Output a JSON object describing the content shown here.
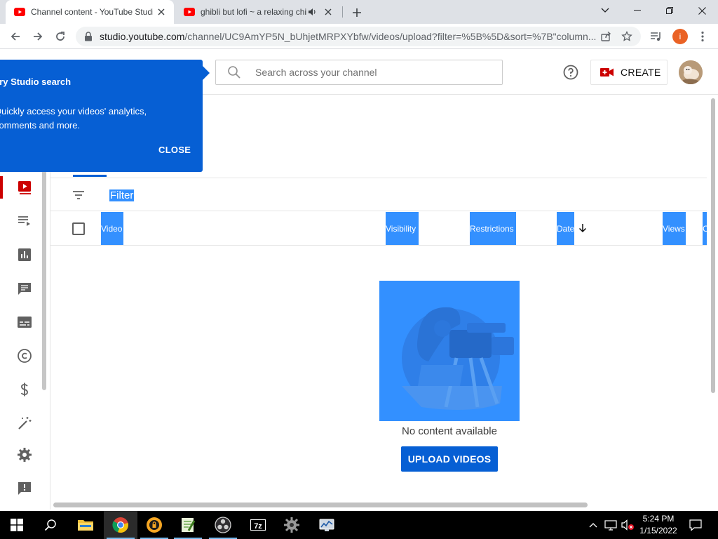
{
  "browser": {
    "tabs": [
      {
        "title": "Channel content - YouTube Studio",
        "active": true
      },
      {
        "title": "ghibli but lofi ~ a relaxing chill",
        "active": false,
        "audio": true
      }
    ],
    "url_host": "studio.youtube.com",
    "url_path": "/channel/UC9AmYP5N_bUhjetMRPXYbfw/videos/upload?filter=%5B%5D&sort=%7B\"column...",
    "profile_initial": "i"
  },
  "studio": {
    "search_placeholder": "Search across your channel",
    "create_label": "CREATE"
  },
  "tooltip": {
    "title": "Try Studio search",
    "body_line1": "Quickly access your videos' analytics,",
    "body_line2": "comments and more.",
    "close_label": "CLOSE"
  },
  "table": {
    "filter_label": "Filter",
    "columns": [
      "Video",
      "Visibility",
      "Restrictions",
      "Date",
      "Views",
      "C"
    ]
  },
  "empty_state": {
    "message": "No content available",
    "upload_label": "UPLOAD VIDEOS"
  },
  "taskbar": {
    "time": "5:24 PM",
    "date": "1/15/2022"
  },
  "colors": {
    "accent": "#065fd4",
    "youtube_red": "#ff0000",
    "selection": "#3390ff"
  }
}
